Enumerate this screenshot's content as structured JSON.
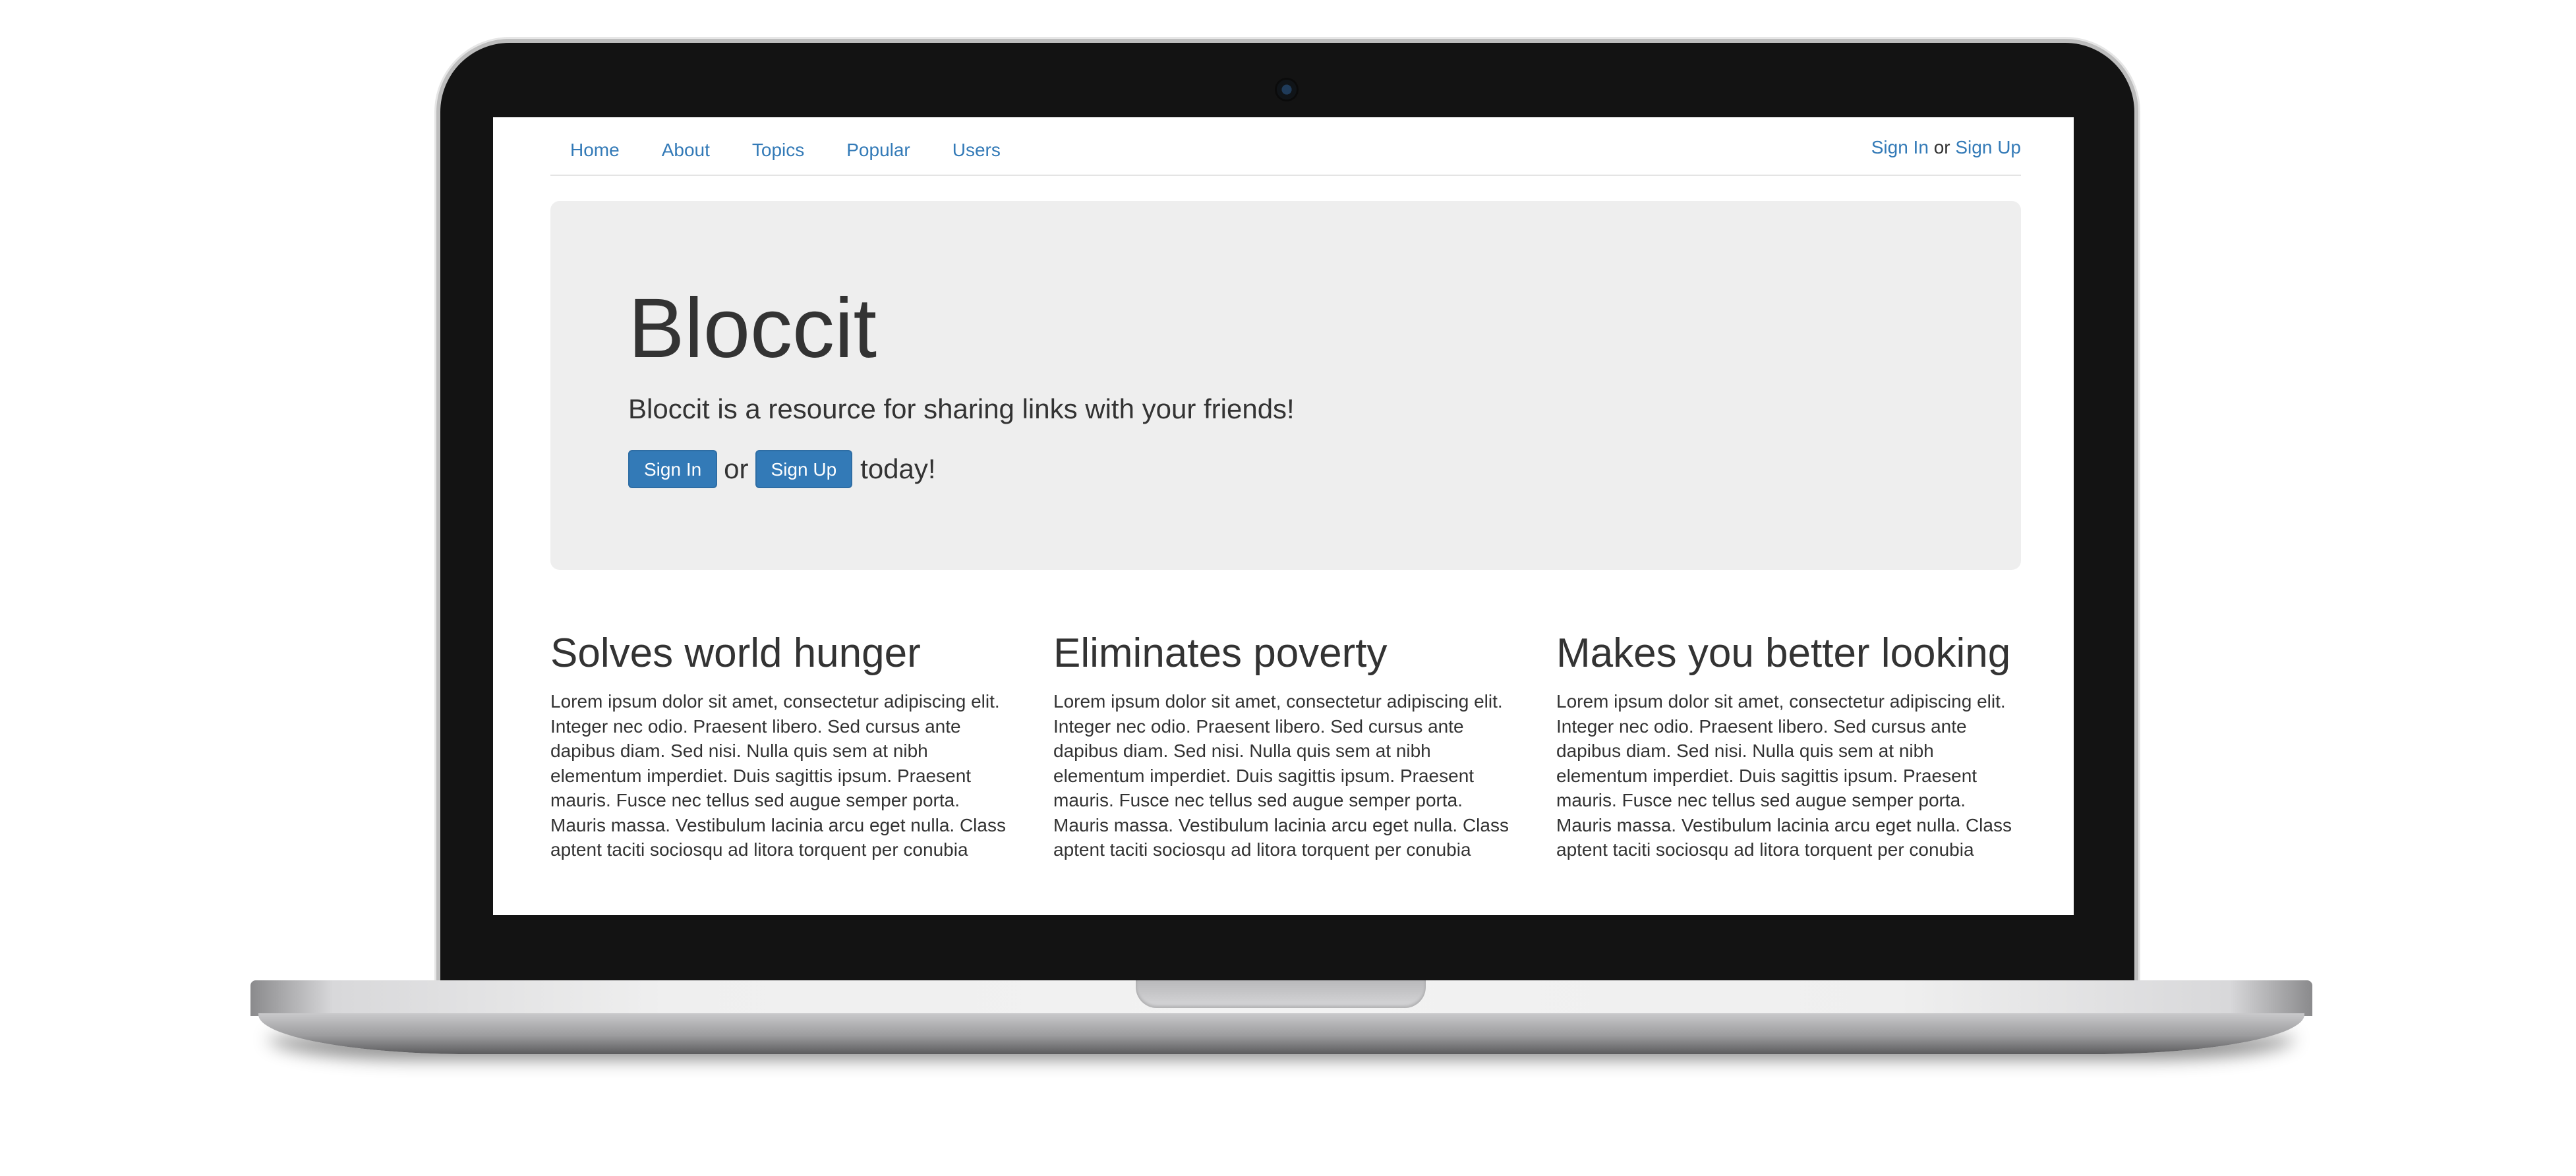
{
  "nav": {
    "links": [
      "Home",
      "About",
      "Topics",
      "Popular",
      "Users"
    ],
    "sign_in": "Sign In",
    "or": "or",
    "sign_up": "Sign Up"
  },
  "jumbotron": {
    "title": "Bloccit",
    "subtitle": "Bloccit is a resource for sharing links with your friends!",
    "sign_in_button": "Sign In",
    "or": "or",
    "sign_up_button": "Sign Up",
    "today": "today!"
  },
  "features": [
    {
      "heading": "Solves world hunger",
      "body": "Lorem ipsum dolor sit amet, consectetur adipiscing elit. Integer nec odio. Praesent libero. Sed cursus ante dapibus diam. Sed nisi. Nulla quis sem at nibh elementum imperdiet. Duis sagittis ipsum. Praesent mauris. Fusce nec tellus sed augue semper porta. Mauris massa. Vestibulum lacinia arcu eget nulla. Class aptent taciti sociosqu ad litora torquent per conubia"
    },
    {
      "heading": "Eliminates poverty",
      "body": "Lorem ipsum dolor sit amet, consectetur adipiscing elit. Integer nec odio. Praesent libero. Sed cursus ante dapibus diam. Sed nisi. Nulla quis sem at nibh elementum imperdiet. Duis sagittis ipsum. Praesent mauris. Fusce nec tellus sed augue semper porta. Mauris massa. Vestibulum lacinia arcu eget nulla. Class aptent taciti sociosqu ad litora torquent per conubia"
    },
    {
      "heading": "Makes you better looking",
      "body": "Lorem ipsum dolor sit amet, consectetur adipiscing elit. Integer nec odio. Praesent libero. Sed cursus ante dapibus diam. Sed nisi. Nulla quis sem at nibh elementum imperdiet. Duis sagittis ipsum. Praesent mauris. Fusce nec tellus sed augue semper porta. Mauris massa. Vestibulum lacinia arcu eget nulla. Class aptent taciti sociosqu ad litora torquent per conubia"
    }
  ],
  "colors": {
    "link": "#337ab7",
    "jumbotron_bg": "#eeeeee",
    "text": "#333333",
    "laptop_bezel": "#131313"
  }
}
